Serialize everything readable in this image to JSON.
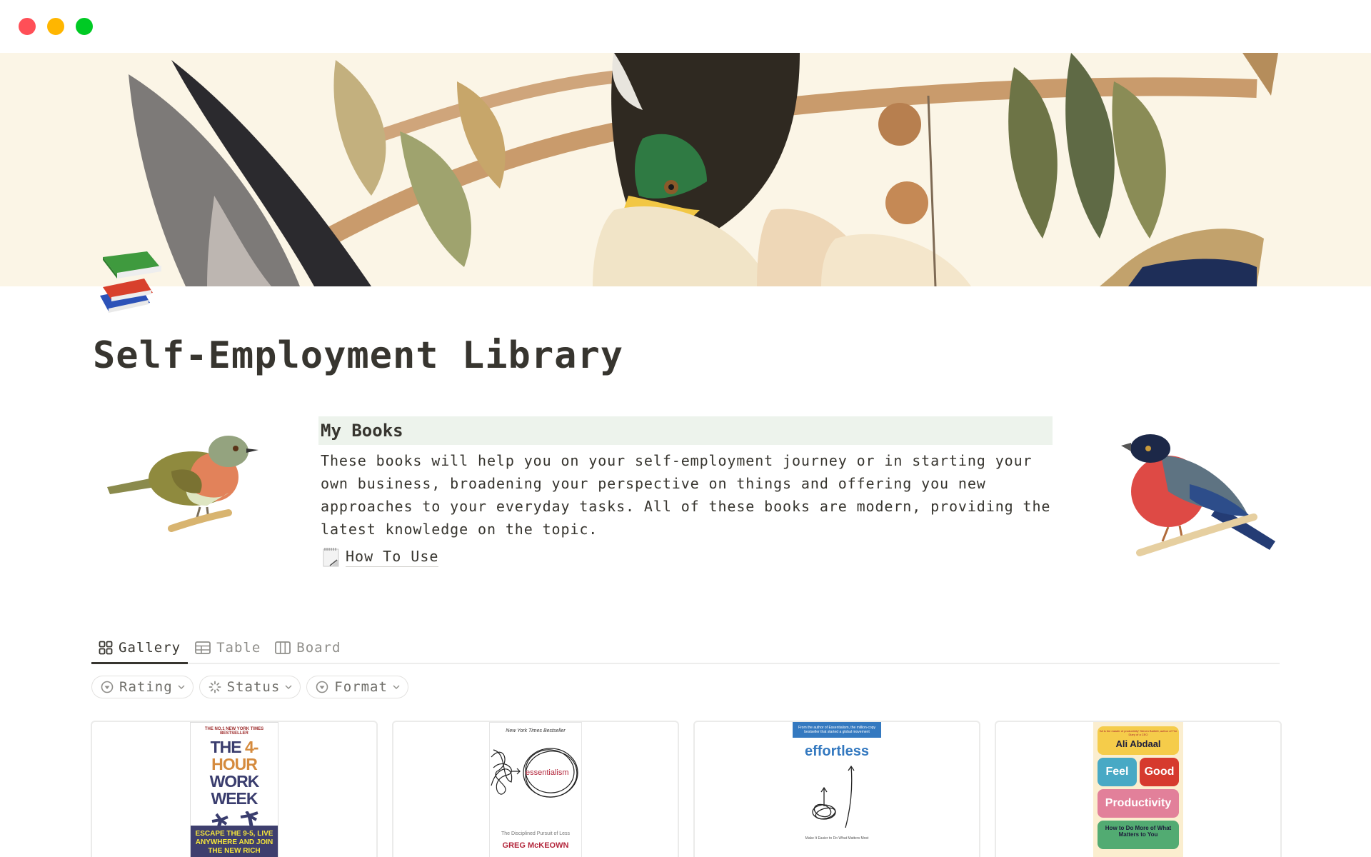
{
  "window": {
    "controls": [
      "close",
      "minimize",
      "maximize"
    ],
    "colors": {
      "close": "#ff4f57",
      "minimize": "#ffb600",
      "maximize": "#00ca24"
    }
  },
  "page": {
    "icon": "books-emoji",
    "title": "Self-Employment Library"
  },
  "intro": {
    "heading": "My Books",
    "heading_bg": "#edf3ec",
    "body": "These books will help you on your self-employment journey or in starting your own business, broadening your perspective on things and offering you new approaches to your everyday tasks. All of these books are modern, providing the latest knowledge on the topic.",
    "link": {
      "icon": "notepad-icon",
      "label": "How To Use"
    }
  },
  "views": {
    "tabs": [
      {
        "label": "Gallery",
        "icon": "gallery-icon",
        "active": true
      },
      {
        "label": "Table",
        "icon": "table-icon",
        "active": false
      },
      {
        "label": "Board",
        "icon": "board-icon",
        "active": false
      }
    ]
  },
  "filters": [
    {
      "label": "Rating",
      "icon": "select-icon"
    },
    {
      "label": "Status",
      "icon": "status-icon"
    },
    {
      "label": "Format",
      "icon": "select-icon"
    }
  ],
  "gallery": {
    "cards": [
      {
        "tag": "THE NO.1 NEW YORK TIMES BESTSELLER",
        "title_a": "THE ",
        "title_b": "4-HOUR",
        "title_c": "WORK WEEK",
        "band": "ESCAPE THE 9-5, LIVE ANYWHERE AND JOIN THE NEW RICH"
      },
      {
        "tag": "New York Times Bestseller",
        "title": "essentialism",
        "subtitle": "The Disciplined Pursuit of Less",
        "author": "GREG McKEOWN"
      },
      {
        "band": "From the author of Essentialism, the million-copy bestseller that started a global movement",
        "title": "effortless",
        "subtitle": "Make It Easier to Do What Matters Most"
      },
      {
        "quote": "'Ali is the master of productivity' Steven Bartlett, author of The Diary of a CEO",
        "author": "Ali Abdaal",
        "word1": "Feel",
        "word2": "Good",
        "word3": "Productivity",
        "subtitle": "How to Do More of What Matters to You"
      }
    ]
  }
}
